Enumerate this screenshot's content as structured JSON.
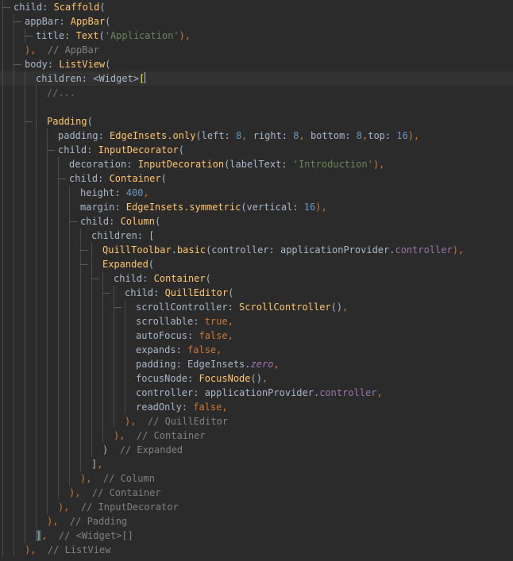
{
  "editor": {
    "lines": [
      [
        [
          "k",
          "child: "
        ],
        [
          "c",
          "Scaffold"
        ],
        [
          "k",
          "("
        ]
      ],
      [
        [
          "k",
          "appBar: "
        ],
        [
          "c",
          "AppBar"
        ],
        [
          "k",
          "("
        ]
      ],
      [
        [
          "k",
          "title: "
        ],
        [
          "c",
          "Text"
        ],
        [
          "k",
          "("
        ],
        [
          "s",
          "'Application'"
        ],
        [
          "kw",
          "),"
        ]
      ],
      [
        [
          "kw",
          "),"
        ],
        [
          "k",
          "  "
        ],
        [
          "cm",
          "// AppBar"
        ]
      ],
      [
        [
          "k",
          "body: "
        ],
        [
          "c",
          "ListView"
        ],
        [
          "k",
          "("
        ]
      ],
      [
        [
          "k",
          "children: <Widget>"
        ],
        [
          "br",
          "["
        ]
      ],
      [
        [
          "fold",
          "//..."
        ]
      ],
      [],
      [
        [
          "c",
          "Padding"
        ],
        [
          "k",
          "("
        ]
      ],
      [
        [
          "k",
          "padding: "
        ],
        [
          "c",
          "EdgeInsets"
        ],
        [
          "k",
          "."
        ],
        [
          "c",
          "only"
        ],
        [
          "k",
          "(left: "
        ],
        [
          "n",
          "8"
        ],
        [
          "kw",
          ", "
        ],
        [
          "k",
          "right: "
        ],
        [
          "n",
          "8"
        ],
        [
          "kw",
          ", "
        ],
        [
          "k",
          "bottom: "
        ],
        [
          "n",
          "8"
        ],
        [
          "kw",
          ","
        ],
        [
          "k",
          "top: "
        ],
        [
          "n",
          "16"
        ],
        [
          "kw",
          "),"
        ]
      ],
      [
        [
          "k",
          "child: "
        ],
        [
          "c",
          "InputDecorator"
        ],
        [
          "k",
          "("
        ]
      ],
      [
        [
          "k",
          "decoration: "
        ],
        [
          "c",
          "InputDecoration"
        ],
        [
          "k",
          "(labelText: "
        ],
        [
          "s",
          "'Introduction'"
        ],
        [
          "kw",
          "),"
        ]
      ],
      [
        [
          "k",
          "child: "
        ],
        [
          "c",
          "Container"
        ],
        [
          "k",
          "("
        ]
      ],
      [
        [
          "k",
          "height: "
        ],
        [
          "n",
          "400"
        ],
        [
          "kw",
          ","
        ]
      ],
      [
        [
          "k",
          "margin: "
        ],
        [
          "c",
          "EdgeInsets"
        ],
        [
          "k",
          "."
        ],
        [
          "c",
          "symmetric"
        ],
        [
          "k",
          "(vertical: "
        ],
        [
          "n",
          "16"
        ],
        [
          "kw",
          "),"
        ]
      ],
      [
        [
          "k",
          "child: "
        ],
        [
          "c",
          "Column"
        ],
        [
          "k",
          "("
        ]
      ],
      [
        [
          "k",
          "children: ["
        ]
      ],
      [
        [
          "c",
          "QuillToolbar"
        ],
        [
          "k",
          "."
        ],
        [
          "c",
          "basic"
        ],
        [
          "k",
          "(controller: applicationProvider."
        ],
        [
          "p",
          "controller"
        ],
        [
          "kw",
          "),"
        ]
      ],
      [
        [
          "c",
          "Expanded"
        ],
        [
          "k",
          "("
        ]
      ],
      [
        [
          "k",
          "child: "
        ],
        [
          "c",
          "Container"
        ],
        [
          "k",
          "("
        ]
      ],
      [
        [
          "k",
          "child: "
        ],
        [
          "c",
          "QuillEditor"
        ],
        [
          "k",
          "("
        ]
      ],
      [
        [
          "k",
          "scrollController: "
        ],
        [
          "c",
          "ScrollController"
        ],
        [
          "k",
          "()"
        ],
        [
          "kw",
          ","
        ]
      ],
      [
        [
          "k",
          "scrollable: "
        ],
        [
          "kw",
          "true,"
        ]
      ],
      [
        [
          "k",
          "autoFocus: "
        ],
        [
          "kw",
          "false,"
        ]
      ],
      [
        [
          "k",
          "expands: "
        ],
        [
          "kw",
          "false,"
        ]
      ],
      [
        [
          "k",
          "padding: EdgeInsets."
        ],
        [
          "pi",
          "zero"
        ],
        [
          "kw",
          ","
        ]
      ],
      [
        [
          "k",
          "focusNode: "
        ],
        [
          "c",
          "FocusNode"
        ],
        [
          "k",
          "()"
        ],
        [
          "kw",
          ","
        ]
      ],
      [
        [
          "k",
          "controller: applicationProvider."
        ],
        [
          "p",
          "controller"
        ],
        [
          "kw",
          ","
        ]
      ],
      [
        [
          "k",
          "readOnly: "
        ],
        [
          "kw",
          "false,"
        ]
      ],
      [
        [
          "kw",
          "),"
        ],
        [
          "k",
          "  "
        ],
        [
          "cm",
          "// QuillEditor"
        ]
      ],
      [
        [
          "kw",
          "),"
        ],
        [
          "k",
          "  "
        ],
        [
          "cm",
          "// Container"
        ]
      ],
      [
        [
          "k",
          ")  "
        ],
        [
          "cm",
          "// Expanded"
        ]
      ],
      [
        [
          "k",
          "]"
        ],
        [
          "kw",
          ","
        ]
      ],
      [
        [
          "kw",
          "),"
        ],
        [
          "k",
          "  "
        ],
        [
          "cm",
          "// Column"
        ]
      ],
      [
        [
          "kw",
          "),"
        ],
        [
          "k",
          "  "
        ],
        [
          "cm",
          "// Container"
        ]
      ],
      [
        [
          "kw",
          "),"
        ],
        [
          "k",
          "  "
        ],
        [
          "cm",
          "// InputDecorator"
        ]
      ],
      [
        [
          "kw",
          "),"
        ],
        [
          "k",
          "  "
        ],
        [
          "cm",
          "// Padding"
        ]
      ],
      [
        [
          "bg",
          "]"
        ],
        [
          "kw",
          ","
        ],
        [
          "k",
          "  "
        ],
        [
          "cm",
          "// <Widget>[]"
        ]
      ],
      [
        [
          "kw",
          "),"
        ],
        [
          "k",
          "  "
        ],
        [
          "cm",
          "// ListView"
        ]
      ]
    ]
  }
}
